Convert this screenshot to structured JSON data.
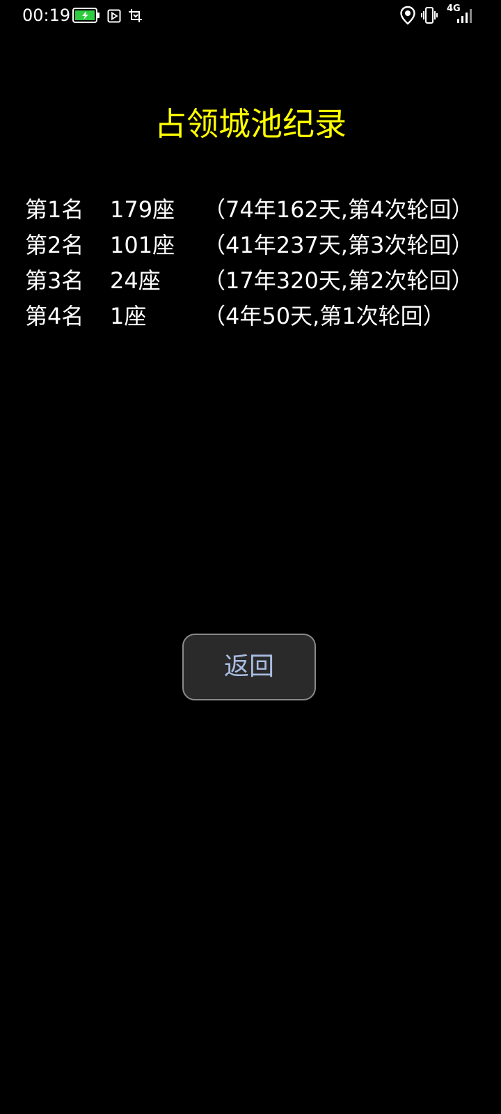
{
  "status_bar": {
    "time": "00:19",
    "network": "4G",
    "icons": [
      "battery-charging-icon",
      "media-play-icon",
      "screenshot-icon",
      "location-icon",
      "vibrate-icon",
      "signal-icon"
    ],
    "battery_color": "#2ecc40"
  },
  "page": {
    "title": "占领城池纪录",
    "title_color": "#ffff00"
  },
  "records": [
    {
      "rank": "第1名",
      "count": "179座",
      "detail": "（74年162天,第4次轮回）"
    },
    {
      "rank": "第2名",
      "count": "101座",
      "detail": "（41年237天,第3次轮回）"
    },
    {
      "rank": "第3名",
      "count": "24座",
      "detail": "（17年320天,第2次轮回）"
    },
    {
      "rank": "第4名",
      "count": "1座",
      "detail": "（4年50天,第1次轮回）"
    }
  ],
  "actions": {
    "back_label": "返回"
  }
}
